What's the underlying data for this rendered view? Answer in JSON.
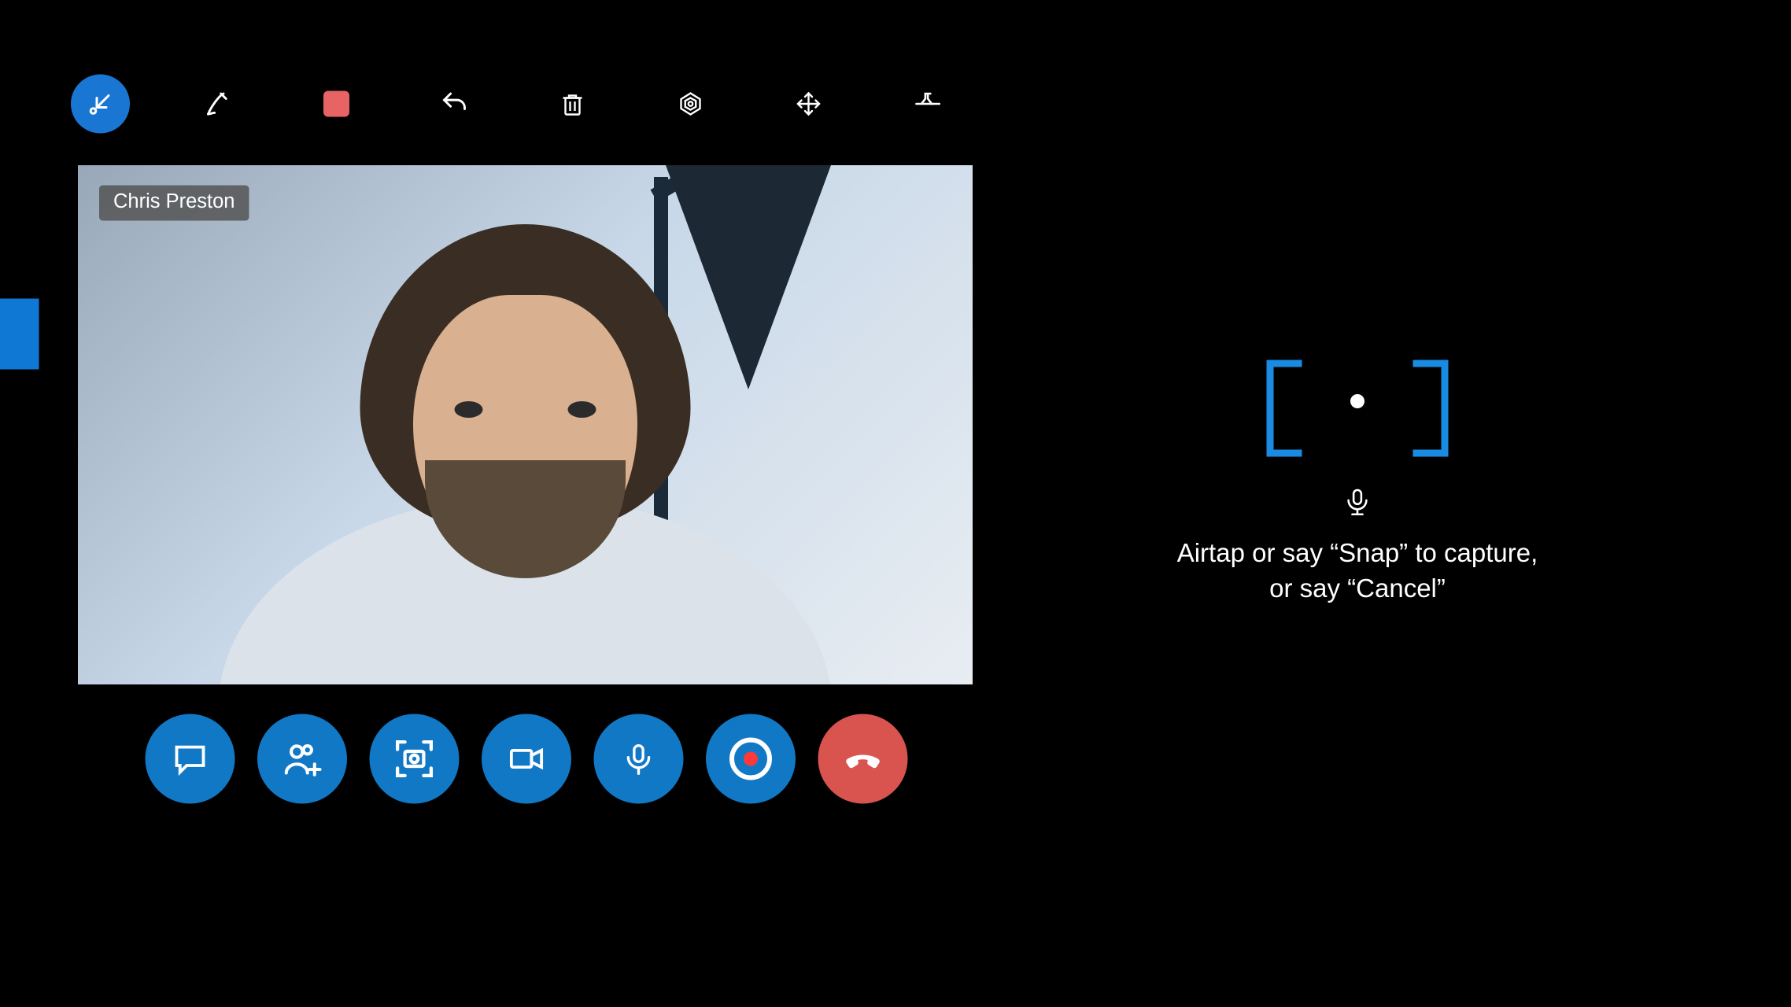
{
  "participant": {
    "name": "Chris Preston"
  },
  "toolbar": {
    "items": [
      {
        "id": "collapse_tool",
        "icon": "collapse-arrow-icon"
      },
      {
        "id": "ink_tool",
        "icon": "pen-signature-icon"
      },
      {
        "id": "stop_tool",
        "icon": "stop-square-icon"
      },
      {
        "id": "undo_tool",
        "icon": "undo-icon"
      },
      {
        "id": "delete_tool",
        "icon": "trash-icon"
      },
      {
        "id": "target_tool",
        "icon": "target-icon"
      },
      {
        "id": "move_tool",
        "icon": "move-arrows-icon"
      },
      {
        "id": "pin_tool",
        "icon": "pin-icon"
      }
    ]
  },
  "call_controls": {
    "items": [
      {
        "id": "chat_btn",
        "icon": "chat-bubble-icon"
      },
      {
        "id": "add_person_btn",
        "icon": "person-add-icon"
      },
      {
        "id": "camera_capture_btn",
        "icon": "camera-focus-icon"
      },
      {
        "id": "video_btn",
        "icon": "video-camera-icon"
      },
      {
        "id": "mic_btn",
        "icon": "microphone-icon"
      },
      {
        "id": "record_btn",
        "icon": "record-dot-icon"
      },
      {
        "id": "hangup_btn",
        "icon": "hangup-icon"
      }
    ]
  },
  "capture_hint": {
    "line1": "Airtap or say “Snap” to capture,",
    "line2": "or say “Cancel”"
  },
  "colors": {
    "accent": "#0f78d4",
    "btn_blue": "#1178c6",
    "btn_red": "#d9534f",
    "stop_red": "#e86464"
  }
}
